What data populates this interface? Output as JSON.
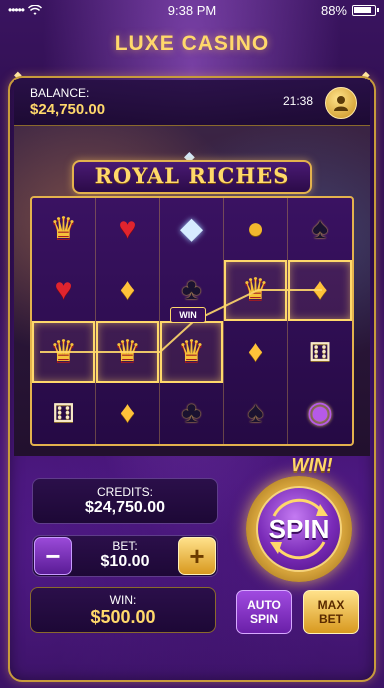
{
  "status_bar": {
    "signal": "•••••",
    "time": "9:38 PM",
    "battery": "88%"
  },
  "app": {
    "title": "LUXE CASINO"
  },
  "header": {
    "balance_label": "BALANCE:",
    "balance_value": "$24,750.00",
    "clock": "21:38"
  },
  "game": {
    "title": "ROYAL RICHES"
  },
  "reels": {
    "rows": [
      [
        "crown",
        "heart",
        "gem",
        "coins",
        "spade"
      ],
      [
        "heart",
        "diamond",
        "club",
        "crown",
        "diamond"
      ],
      [
        "crown",
        "crown",
        "crown",
        "diamond",
        "dice"
      ],
      [
        "dice",
        "diamond",
        "club",
        "spade",
        "ring"
      ]
    ],
    "win_line_label": "WIN"
  },
  "controls": {
    "credits_label": "CREDITS:",
    "credits_value": "$24,750.00",
    "bet_label": "BET:",
    "bet_value": "$10.00",
    "bet_minus": "−",
    "bet_plus": "+",
    "win_label": "WIN:",
    "win_value": "$500.00",
    "win_banner": "WIN!",
    "spin_label": "SPIN",
    "auto_spin_line1": "AUTO",
    "auto_spin_line2": "SPIN",
    "max_bet_line1": "MAX",
    "max_bet_line2": "BET"
  },
  "colors": {
    "accent_gold": "#ffd86b",
    "purple": "#6a1fa8",
    "frame_gold": "#c89b3c"
  }
}
